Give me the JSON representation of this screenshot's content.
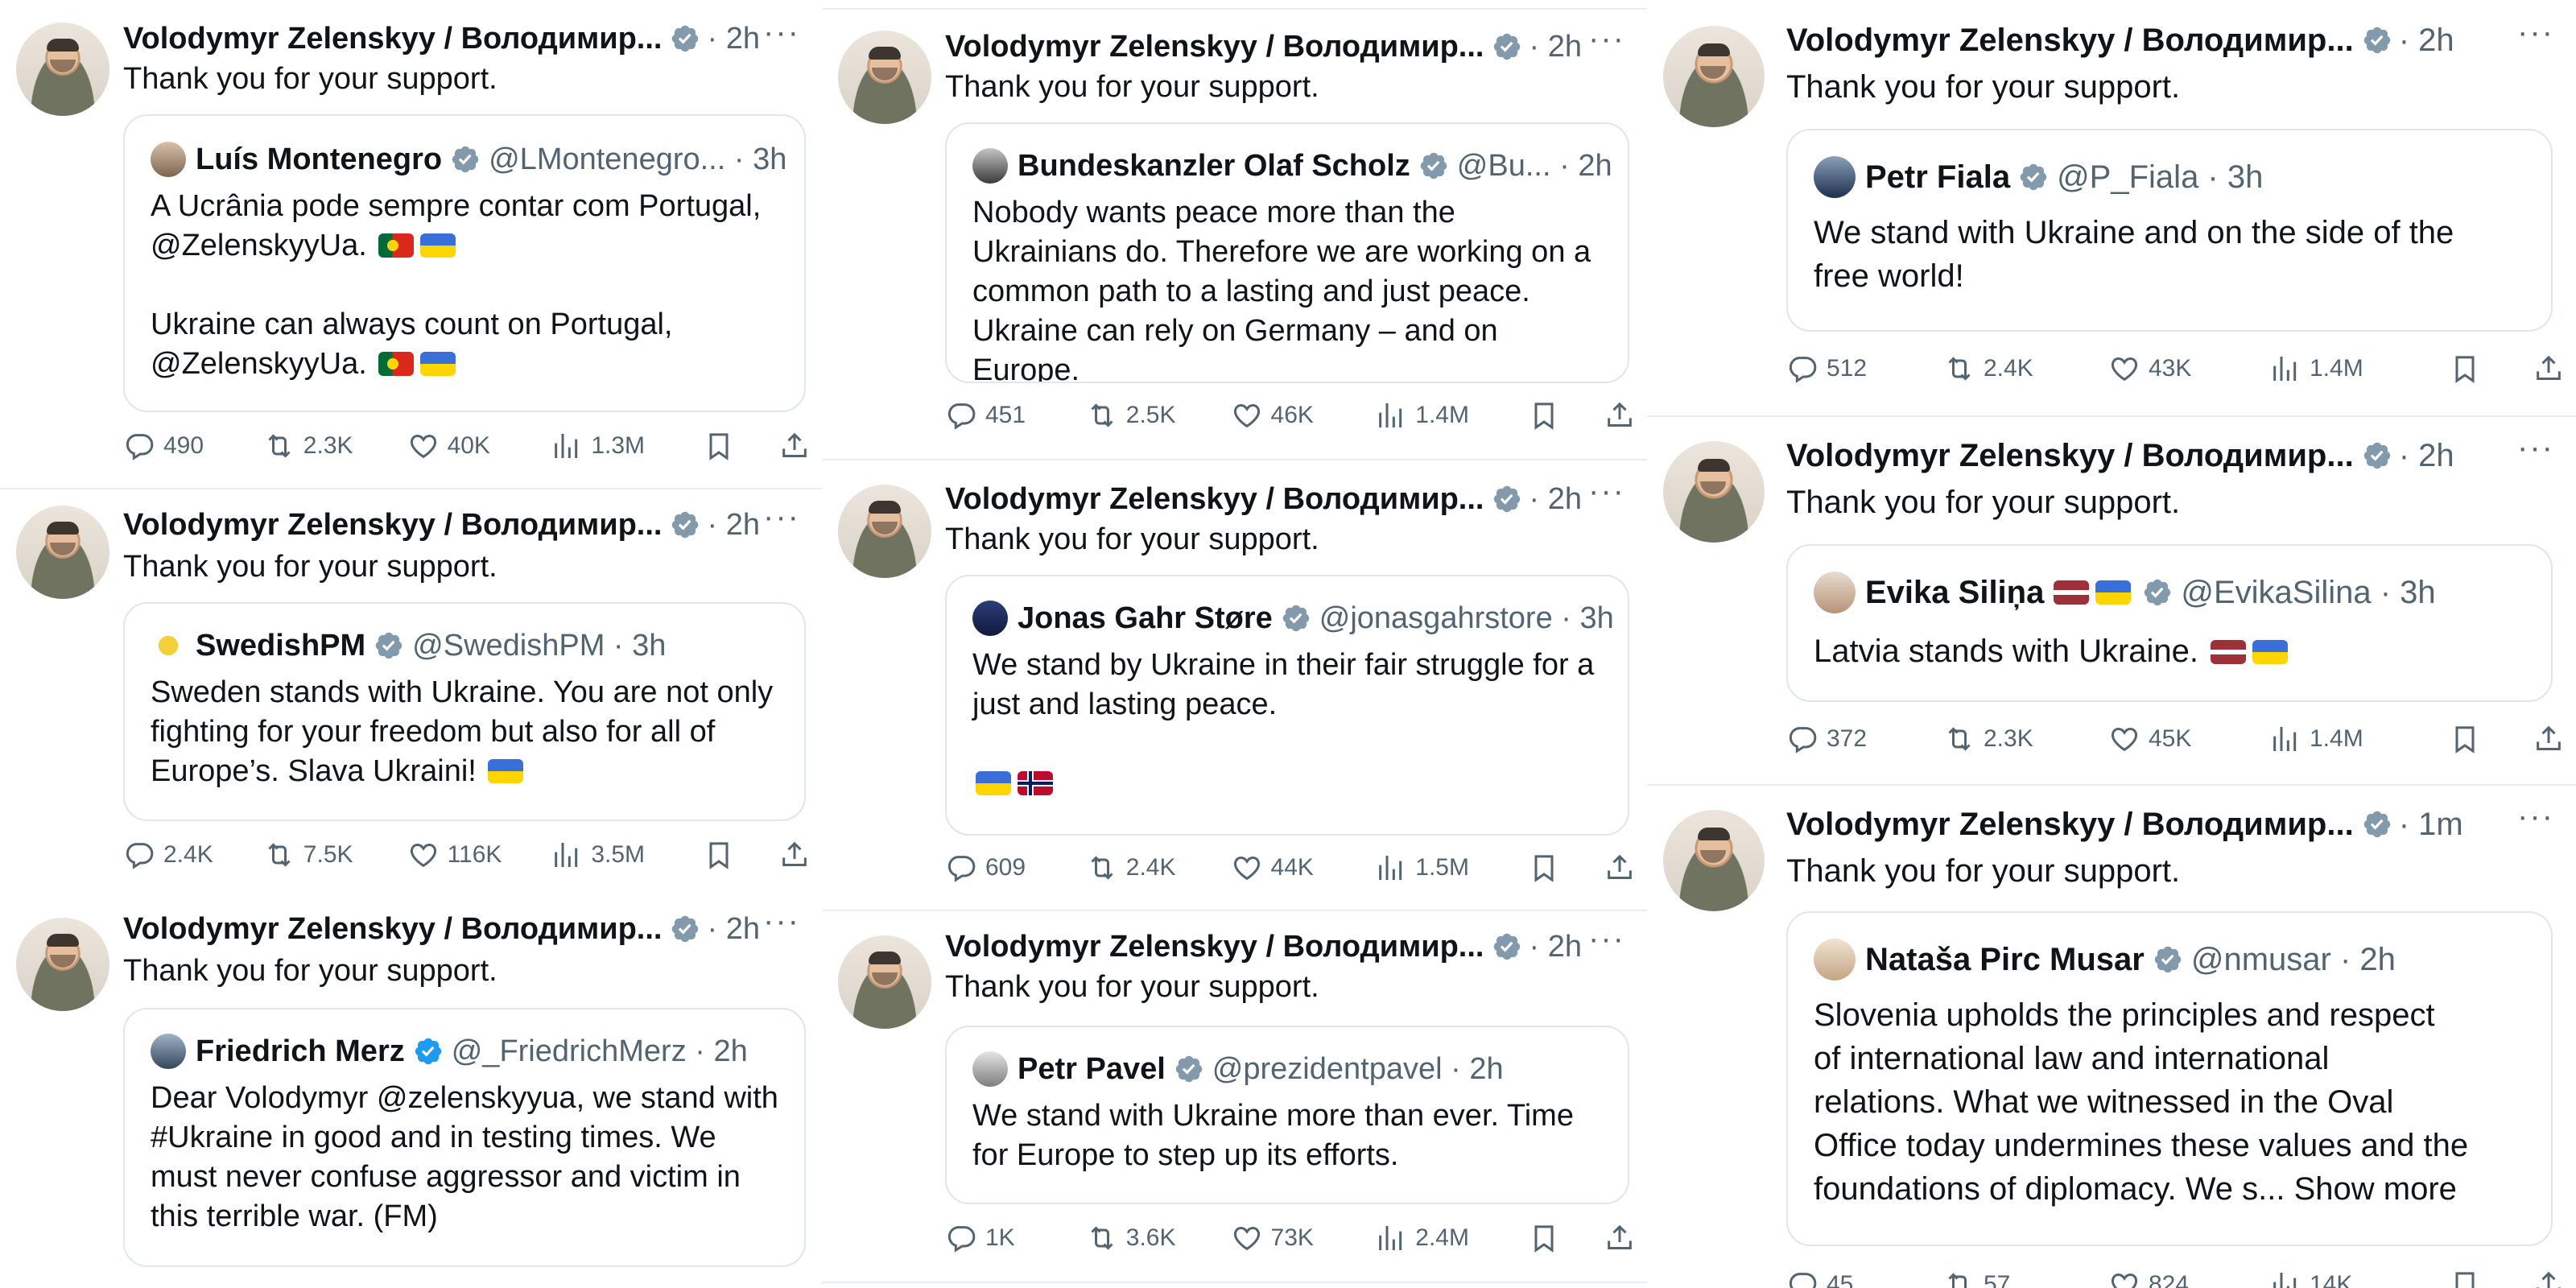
{
  "author_name": "Volodymyr Zelenskyy / Володимир...",
  "reply_text": "Thank you for your support.",
  "columns": [
    [
      {
        "time": "2h",
        "quote_name": "Luís Montenegro",
        "quote_handle": "@LMontenegro...",
        "quote_time": "3h",
        "quote_lines": [
          "A Ucrânia pode sempre contar com Portugal,",
          "@ZelenskyyUa.",
          "",
          "Ukraine can always count on Portugal,",
          "@ZelenskyyUa."
        ],
        "replies": "490",
        "reposts": "2.3K",
        "likes": "40K",
        "views": "1.3M"
      },
      {
        "time": "2h",
        "quote_name": "SwedishPM",
        "quote_handle": "@SwedishPM",
        "quote_time": "3h",
        "quote_lines": [
          "Sweden stands with Ukraine. You are not only",
          "fighting for your freedom but also for all of",
          "Europe’s. Slava Ukraini!"
        ],
        "replies": "2.4K",
        "reposts": "7.5K",
        "likes": "116K",
        "views": "3.5M"
      },
      {
        "time": "2h",
        "quote_name": "Friedrich Merz",
        "quote_handle": "@_FriedrichMerz",
        "quote_time": "2h",
        "quote_lines": [
          "Dear Volodymyr @zelenskyyua, we stand with",
          "#Ukraine in good and in testing times. We",
          "must never confuse aggressor and victim in",
          "this terrible war. (FM)"
        ],
        "replies": "",
        "reposts": "",
        "likes": "",
        "views": ""
      }
    ],
    [
      {
        "time": "2h",
        "quote_name": "Bundeskanzler Olaf Scholz",
        "quote_handle": "@Bu...",
        "quote_time": "2h",
        "quote_lines": [
          "Nobody wants peace more than the",
          "Ukrainians do. Therefore we are working on a",
          "common path to a lasting and just peace.",
          "Ukraine can rely on Germany – and on Europe."
        ],
        "replies": "451",
        "reposts": "2.5K",
        "likes": "46K",
        "views": "1.4M"
      },
      {
        "time": "2h",
        "quote_name": "Jonas Gahr Støre",
        "quote_handle": "@jonasgahrstore",
        "quote_time": "3h",
        "quote_lines": [
          "We stand by Ukraine in their fair struggle for a",
          "just and lasting peace."
        ],
        "replies": "609",
        "reposts": "2.4K",
        "likes": "44K",
        "views": "1.5M"
      },
      {
        "time": "2h",
        "quote_name": "Petr Pavel",
        "quote_handle": "@prezidentpavel",
        "quote_time": "2h",
        "quote_lines": [
          "We stand with Ukraine more than ever. Time",
          "for Europe to step up its efforts."
        ],
        "replies": "1K",
        "reposts": "3.6K",
        "likes": "73K",
        "views": "2.4M"
      }
    ],
    [
      {
        "time": "2h",
        "quote_name": "Petr Fiala",
        "quote_handle": "@P_Fiala",
        "quote_time": "3h",
        "quote_lines": [
          "We stand with Ukraine and on the side of the",
          "free world!"
        ],
        "replies": "512",
        "reposts": "2.4K",
        "likes": "43K",
        "views": "1.4M"
      },
      {
        "time": "2h",
        "quote_name": "Evika Siliņa",
        "quote_handle": "@EvikaSilina",
        "quote_time": "3h",
        "quote_lines": [
          "Latvia stands with Ukraine."
        ],
        "replies": "372",
        "reposts": "2.3K",
        "likes": "45K",
        "views": "1.4M"
      },
      {
        "time": "1m",
        "quote_name": "Nataša Pirc Musar",
        "quote_handle": "@nmusar",
        "quote_time": "2h",
        "quote_lines": [
          "Slovenia upholds the principles and respect",
          "of international law and international",
          "relations. What we witnessed in the Oval",
          "Office today undermines these values and the",
          "foundations of diplomacy. We s... Show more"
        ],
        "replies": "45",
        "reposts": "57",
        "likes": "824",
        "views": "14K"
      }
    ]
  ],
  "icons": [
    "verified-badge-icon",
    "more-icon",
    "reply-icon",
    "repost-icon",
    "like-icon",
    "views-icon",
    "bookmark-icon",
    "share-icon"
  ],
  "colors": {
    "text": "#0f1419",
    "secondary": "#536471",
    "verified_gray": "#829aab",
    "verified_blue": "#1d9bf0",
    "border": "#e1e6ea"
  }
}
